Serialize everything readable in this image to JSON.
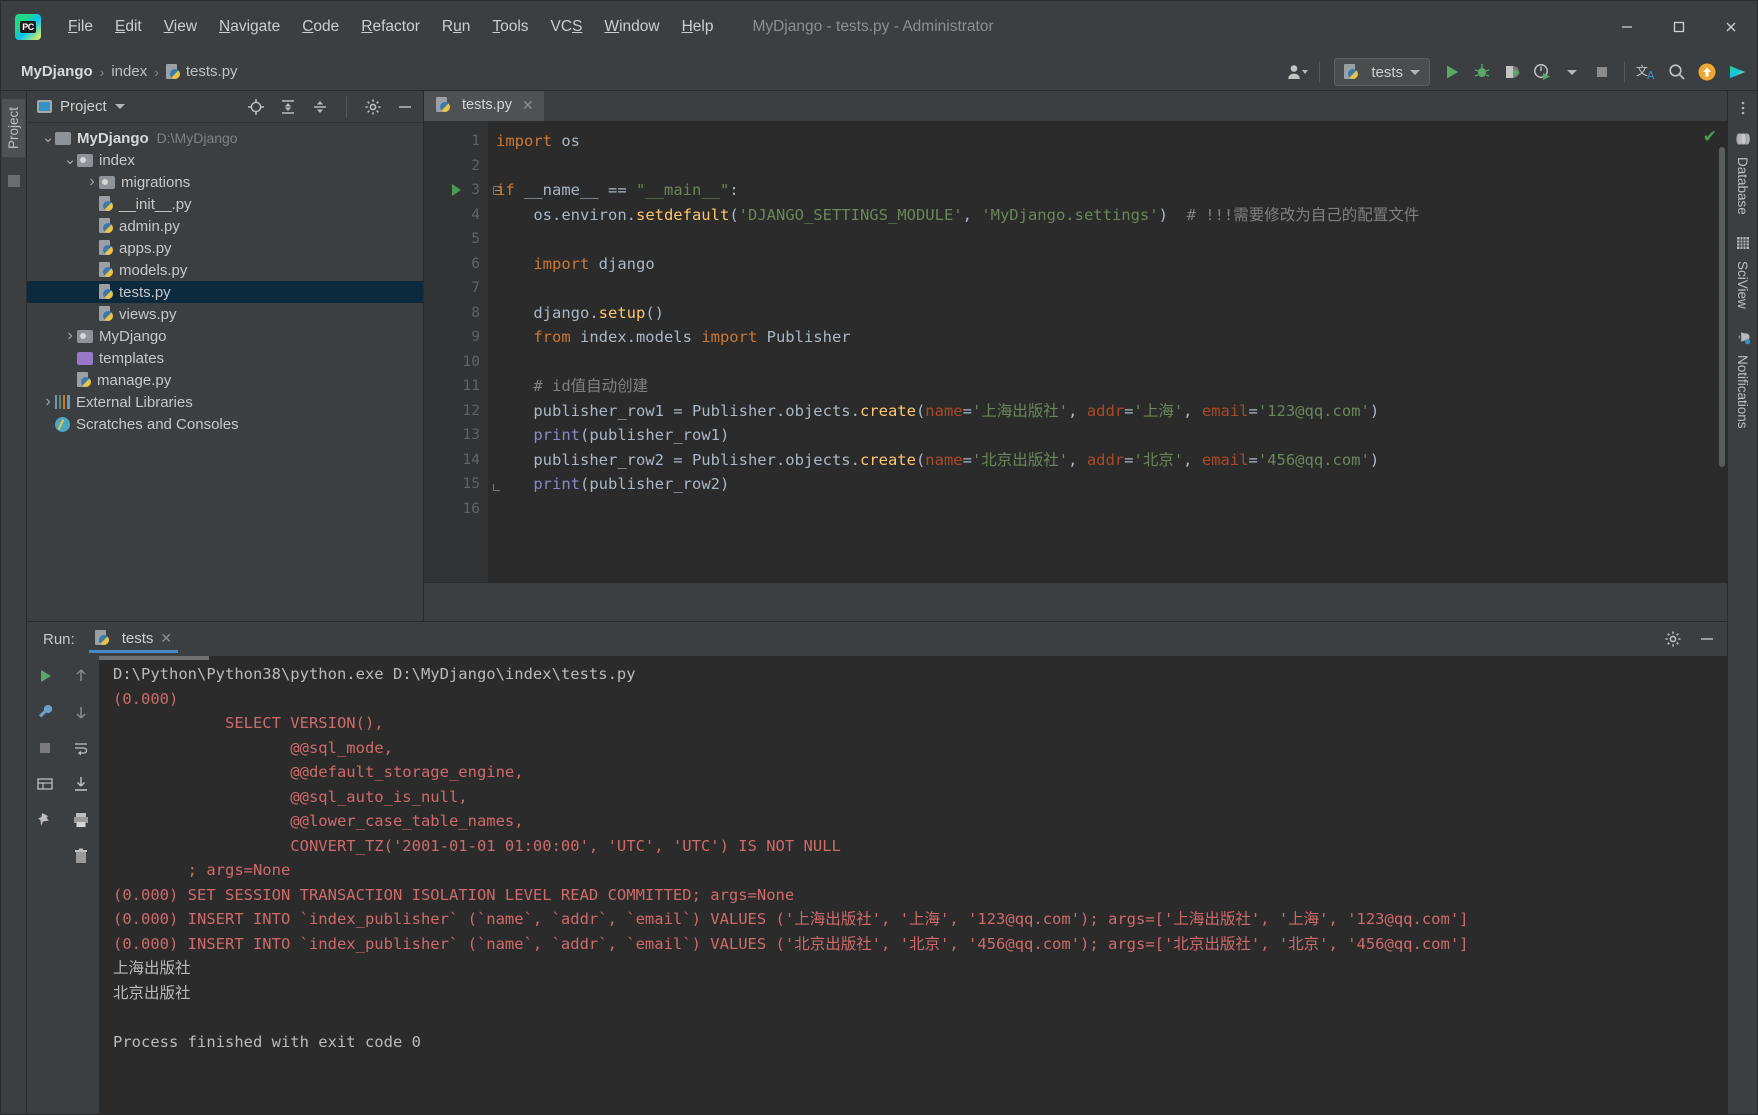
{
  "window": {
    "title": "MyDjango - tests.py - Administrator",
    "logo_text": "PC",
    "minimize": "–",
    "maximize": "☐",
    "close": "✕"
  },
  "menubar": {
    "items": [
      {
        "label": "File",
        "mnemonic": "F"
      },
      {
        "label": "Edit",
        "mnemonic": "E"
      },
      {
        "label": "View",
        "mnemonic": "V"
      },
      {
        "label": "Navigate",
        "mnemonic": "N"
      },
      {
        "label": "Code",
        "mnemonic": "C"
      },
      {
        "label": "Refactor",
        "mnemonic": "R"
      },
      {
        "label": "Run",
        "mnemonic": "u"
      },
      {
        "label": "Tools",
        "mnemonic": "T"
      },
      {
        "label": "VCS",
        "mnemonic": "S"
      },
      {
        "label": "Window",
        "mnemonic": "W"
      },
      {
        "label": "Help",
        "mnemonic": "H"
      }
    ]
  },
  "breadcrumb": {
    "items": [
      "MyDjango",
      "index",
      "tests.py"
    ],
    "separator": "›"
  },
  "toolbar": {
    "run_config_name": "tests",
    "icons": [
      "user-avatar-icon",
      "run-icon",
      "debug-icon",
      "run-coverage-icon",
      "profile-icon",
      "stop-icon",
      "translate-icon",
      "search-everywhere-icon",
      "update-icon",
      "ide-eye-icon"
    ]
  },
  "left_rail": {
    "tabs": [
      "Project"
    ]
  },
  "right_rail": {
    "tabs": [
      "Database",
      "SciView",
      "Notifications"
    ]
  },
  "project_pane": {
    "title": "Project",
    "header_icons": [
      "locate-icon",
      "expand-all-icon",
      "collapse-all-icon",
      "settings-icon",
      "hide-icon"
    ],
    "tree": [
      {
        "label": "MyDjango",
        "path": "D:\\MyDjango",
        "icon": "folder-icon",
        "depth": 0,
        "arrow": "down",
        "bold": true,
        "selected": false
      },
      {
        "label": "index",
        "path": "",
        "icon": "module-folder-icon",
        "depth": 1,
        "arrow": "down",
        "bold": false,
        "selected": false
      },
      {
        "label": "migrations",
        "path": "",
        "icon": "module-folder-icon",
        "depth": 2,
        "arrow": "right",
        "bold": false,
        "selected": false
      },
      {
        "label": "__init__.py",
        "path": "",
        "icon": "python-file-icon",
        "depth": 2,
        "arrow": "",
        "bold": false,
        "selected": false
      },
      {
        "label": "admin.py",
        "path": "",
        "icon": "python-file-icon",
        "depth": 2,
        "arrow": "",
        "bold": false,
        "selected": false
      },
      {
        "label": "apps.py",
        "path": "",
        "icon": "python-file-icon",
        "depth": 2,
        "arrow": "",
        "bold": false,
        "selected": false
      },
      {
        "label": "models.py",
        "path": "",
        "icon": "python-file-icon",
        "depth": 2,
        "arrow": "",
        "bold": false,
        "selected": false
      },
      {
        "label": "tests.py",
        "path": "",
        "icon": "python-file-icon",
        "depth": 2,
        "arrow": "",
        "bold": false,
        "selected": true
      },
      {
        "label": "views.py",
        "path": "",
        "icon": "python-file-icon",
        "depth": 2,
        "arrow": "",
        "bold": false,
        "selected": false
      },
      {
        "label": "MyDjango",
        "path": "",
        "icon": "module-folder-icon",
        "depth": 1,
        "arrow": "right",
        "bold": false,
        "selected": false
      },
      {
        "label": "templates",
        "path": "",
        "icon": "templates-folder-icon",
        "depth": 1,
        "arrow": "",
        "bold": false,
        "selected": false
      },
      {
        "label": "manage.py",
        "path": "",
        "icon": "python-file-icon",
        "depth": 1,
        "arrow": "",
        "bold": false,
        "selected": false
      },
      {
        "label": "External Libraries",
        "path": "",
        "icon": "libraries-icon",
        "depth": 0,
        "arrow": "right",
        "bold": false,
        "selected": false
      },
      {
        "label": "Scratches and Consoles",
        "path": "",
        "icon": "scratches-icon",
        "depth": 0,
        "arrow": "",
        "bold": false,
        "selected": false
      }
    ]
  },
  "editor": {
    "tab_label": "tests.py",
    "tab_close": "✕",
    "inspection_status": "✔",
    "total_lines": 16,
    "lines": [
      {
        "n": 1,
        "text": "import os"
      },
      {
        "n": 2,
        "text": ""
      },
      {
        "n": 3,
        "text": "if __name__ == \"__main__\":"
      },
      {
        "n": 4,
        "text": "    os.environ.setdefault('DJANGO_SETTINGS_MODULE', 'MyDjango.settings')  # !!!需要修改为自己的配置文件"
      },
      {
        "n": 5,
        "text": ""
      },
      {
        "n": 6,
        "text": "    import django"
      },
      {
        "n": 7,
        "text": ""
      },
      {
        "n": 8,
        "text": "    django.setup()"
      },
      {
        "n": 9,
        "text": "    from index.models import Publisher"
      },
      {
        "n": 10,
        "text": ""
      },
      {
        "n": 11,
        "text": "    # id值自动创建"
      },
      {
        "n": 12,
        "text": "    publisher_row1 = Publisher.objects.create(name='上海出版社', addr='上海', email='123@qq.com')"
      },
      {
        "n": 13,
        "text": "    print(publisher_row1)"
      },
      {
        "n": 14,
        "text": "    publisher_row2 = Publisher.objects.create(name='北京出版社', addr='北京', email='456@qq.com')"
      },
      {
        "n": 15,
        "text": "    print(publisher_row2)"
      },
      {
        "n": 16,
        "text": ""
      }
    ]
  },
  "run_panel": {
    "label": "Run:",
    "tab_label": "tests",
    "tab_close": "✕",
    "header_icons": [
      "settings-icon",
      "hide-icon"
    ],
    "toolbar_icons": [
      "rerun-icon",
      "up-stack-icon",
      "down-stack-icon",
      "wrench-icon",
      "soft-wrap-icon",
      "stop-icon",
      "scroll-to-end-icon",
      "print-table-icon",
      "print-icon",
      "pin-icon",
      "trash-icon"
    ],
    "output": [
      {
        "text": "D:\\Python\\Python38\\python.exe D:\\MyDjango\\index\\tests.py",
        "style": "normal"
      },
      {
        "text": "(0.000)",
        "style": "err"
      },
      {
        "text": "            SELECT VERSION(),",
        "style": "err"
      },
      {
        "text": "                   @@sql_mode,",
        "style": "err"
      },
      {
        "text": "                   @@default_storage_engine,",
        "style": "err"
      },
      {
        "text": "                   @@sql_auto_is_null,",
        "style": "err"
      },
      {
        "text": "                   @@lower_case_table_names,",
        "style": "err"
      },
      {
        "text": "                   CONVERT_TZ('2001-01-01 01:00:00', 'UTC', 'UTC') IS NOT NULL",
        "style": "err"
      },
      {
        "text": "        ; args=None",
        "style": "err"
      },
      {
        "text": "(0.000) SET SESSION TRANSACTION ISOLATION LEVEL READ COMMITTED; args=None",
        "style": "err"
      },
      {
        "text": "(0.000) INSERT INTO `index_publisher` (`name`, `addr`, `email`) VALUES ('上海出版社', '上海', '123@qq.com'); args=['上海出版社', '上海', '123@qq.com']",
        "style": "err"
      },
      {
        "text": "(0.000) INSERT INTO `index_publisher` (`name`, `addr`, `email`) VALUES ('北京出版社', '北京', '456@qq.com'); args=['北京出版社', '北京', '456@qq.com']",
        "style": "err"
      },
      {
        "text": "上海出版社",
        "style": "normal"
      },
      {
        "text": "北京出版社",
        "style": "normal"
      },
      {
        "text": "",
        "style": "normal"
      },
      {
        "text": "Process finished with exit code 0",
        "style": "normal"
      }
    ]
  },
  "colors": {
    "chrome": "#3c3f41",
    "editor_bg": "#2b2b2b",
    "gutter_bg": "#313335",
    "selection": "#0d293e",
    "accent_green": "#499c54",
    "accent_blue": "#4a88c7",
    "error_red": "#cf6a6a",
    "keyword": "#cc7832",
    "string": "#6a8759",
    "comment": "#808080"
  }
}
